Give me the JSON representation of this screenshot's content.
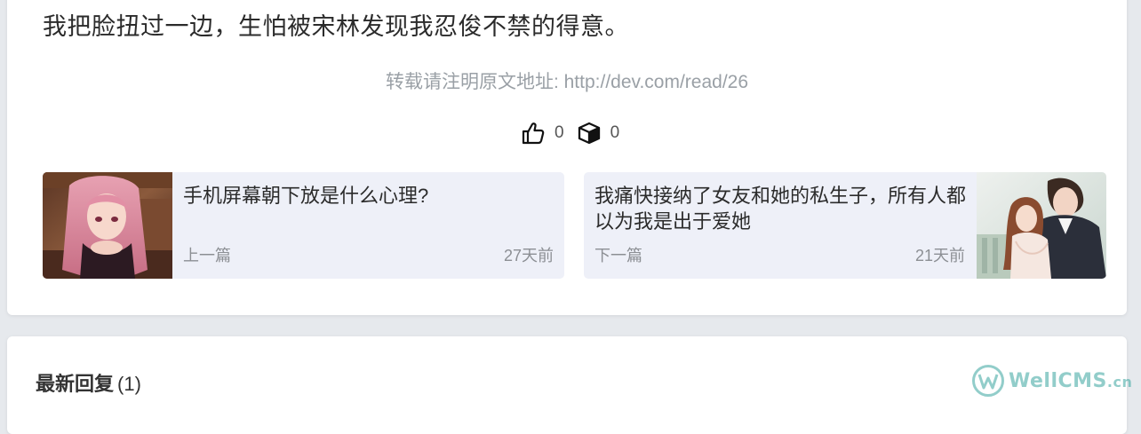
{
  "article": {
    "last_line": "我把脸扭过一边，生怕被宋林发现我忍俊不禁的得意。",
    "reprint_prefix": "转载请注明原文地址: ",
    "reprint_url": "http://dev.com/read/26"
  },
  "actions": {
    "like_icon": "thumbs-up-icon",
    "like_count": "0",
    "favorite_icon": "box-icon",
    "favorite_count": "0"
  },
  "navigation": {
    "prev": {
      "title": "手机屏幕朝下放是什么心理?",
      "label": "上一篇",
      "time": "27天前"
    },
    "next": {
      "title": "我痛快接纳了女友和她的私生子，所有人都以为我是出于爱她",
      "label": "下一篇",
      "time": "21天前"
    }
  },
  "replies": {
    "heading": "最新回复",
    "count": "(1)"
  },
  "watermark": {
    "text": "WellCMS",
    "suffix": ".cn"
  },
  "colors": {
    "page_bg": "#e6e9ed",
    "nav_card_bg": "#eef0f8",
    "muted_text": "#9aa0a6",
    "watermark": "#3aa6a0"
  }
}
